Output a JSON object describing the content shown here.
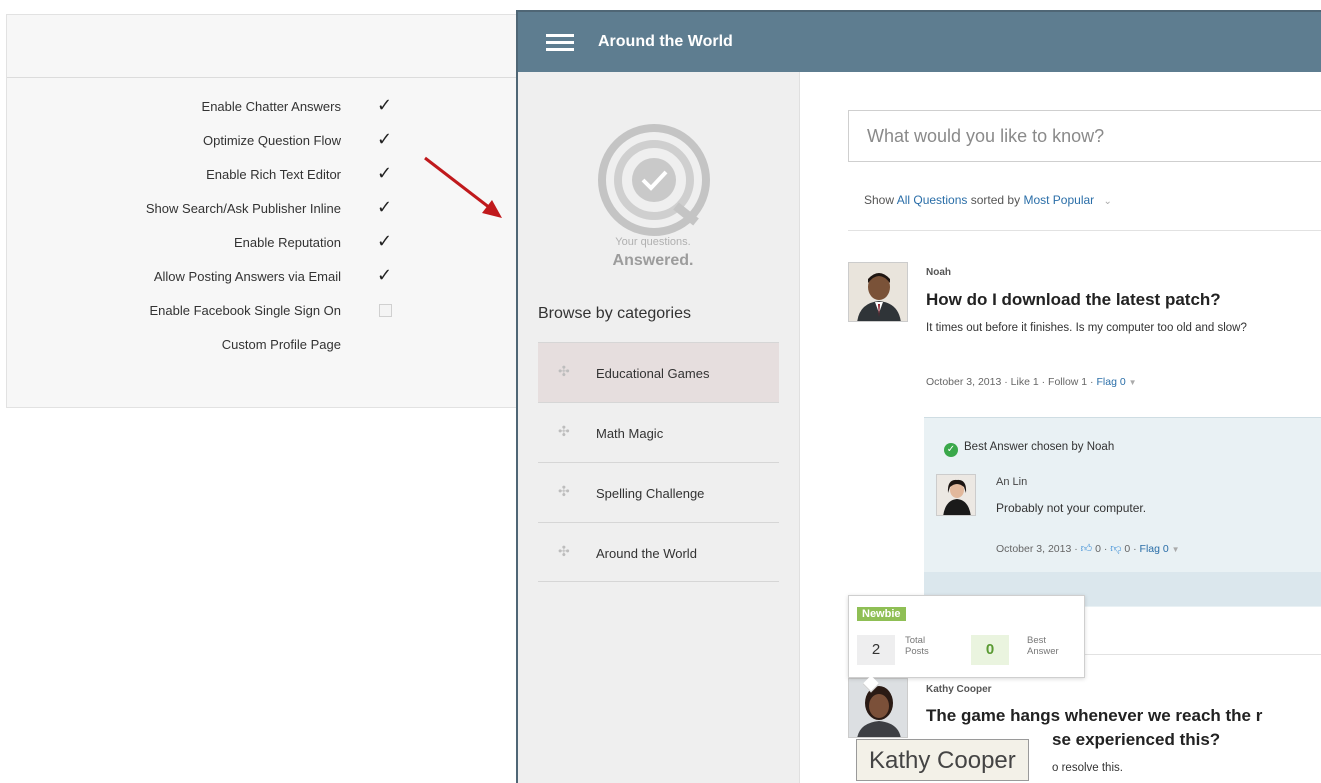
{
  "settings": {
    "rows": [
      {
        "label": "Enable Chatter Answers",
        "checked": true
      },
      {
        "label": "Optimize Question Flow",
        "checked": true
      },
      {
        "label": "Enable Rich Text Editor",
        "checked": true
      },
      {
        "label": "Show Search/Ask Publisher Inline",
        "checked": true
      },
      {
        "label": "Enable Reputation",
        "checked": true
      },
      {
        "label": "Allow Posting Answers via Email",
        "checked": true
      },
      {
        "label": "Enable Facebook Single Sign On",
        "checked": false
      },
      {
        "label": "Custom Profile Page",
        "checked": null
      }
    ]
  },
  "app": {
    "title": "Around the World"
  },
  "sidebar": {
    "logo_small": "Your questions.",
    "logo_big": "Answered.",
    "browse_title": "Browse by categories",
    "categories": [
      {
        "label": "Educational Games",
        "active": true
      },
      {
        "label": "Math Magic",
        "active": false
      },
      {
        "label": "Spelling Challenge",
        "active": false
      },
      {
        "label": "Around the World",
        "active": false
      }
    ]
  },
  "main": {
    "search_placeholder": "What would you like to know?",
    "filter": {
      "show": "Show",
      "scope": "All Questions",
      "sorted_by": "sorted by",
      "sort": "Most Popular",
      "caret": "⌄"
    },
    "question1": {
      "author": "Noah",
      "title": "How do I download the latest patch?",
      "body": "It times out before it finishes. Is my computer too old and slow?",
      "meta_date": "October 3, 2013",
      "meta_like": "Like 1",
      "meta_follow": "Follow 1",
      "meta_flag": "Flag 0",
      "best_answer": "Best Answer chosen by Noah",
      "answer_author": "An Lin",
      "answer_body": "Probably not your computer.",
      "answer_date": "October 3, 2013",
      "answer_up": "0",
      "answer_down": "0",
      "answer_flag": "Flag 0"
    },
    "hovercard": {
      "badge": "Newbie",
      "posts_value": "2",
      "posts_label_1": "Total",
      "posts_label_2": "Posts",
      "best_value": "0",
      "best_label_1": "Best",
      "best_label_2": "Answer"
    },
    "question2": {
      "author": "Kathy Cooper",
      "title_line1": "The game hangs whenever we reach the r",
      "title_line2": "se experienced this?",
      "body_fragment": "o resolve this."
    },
    "tooltip": "Kathy Cooper"
  }
}
